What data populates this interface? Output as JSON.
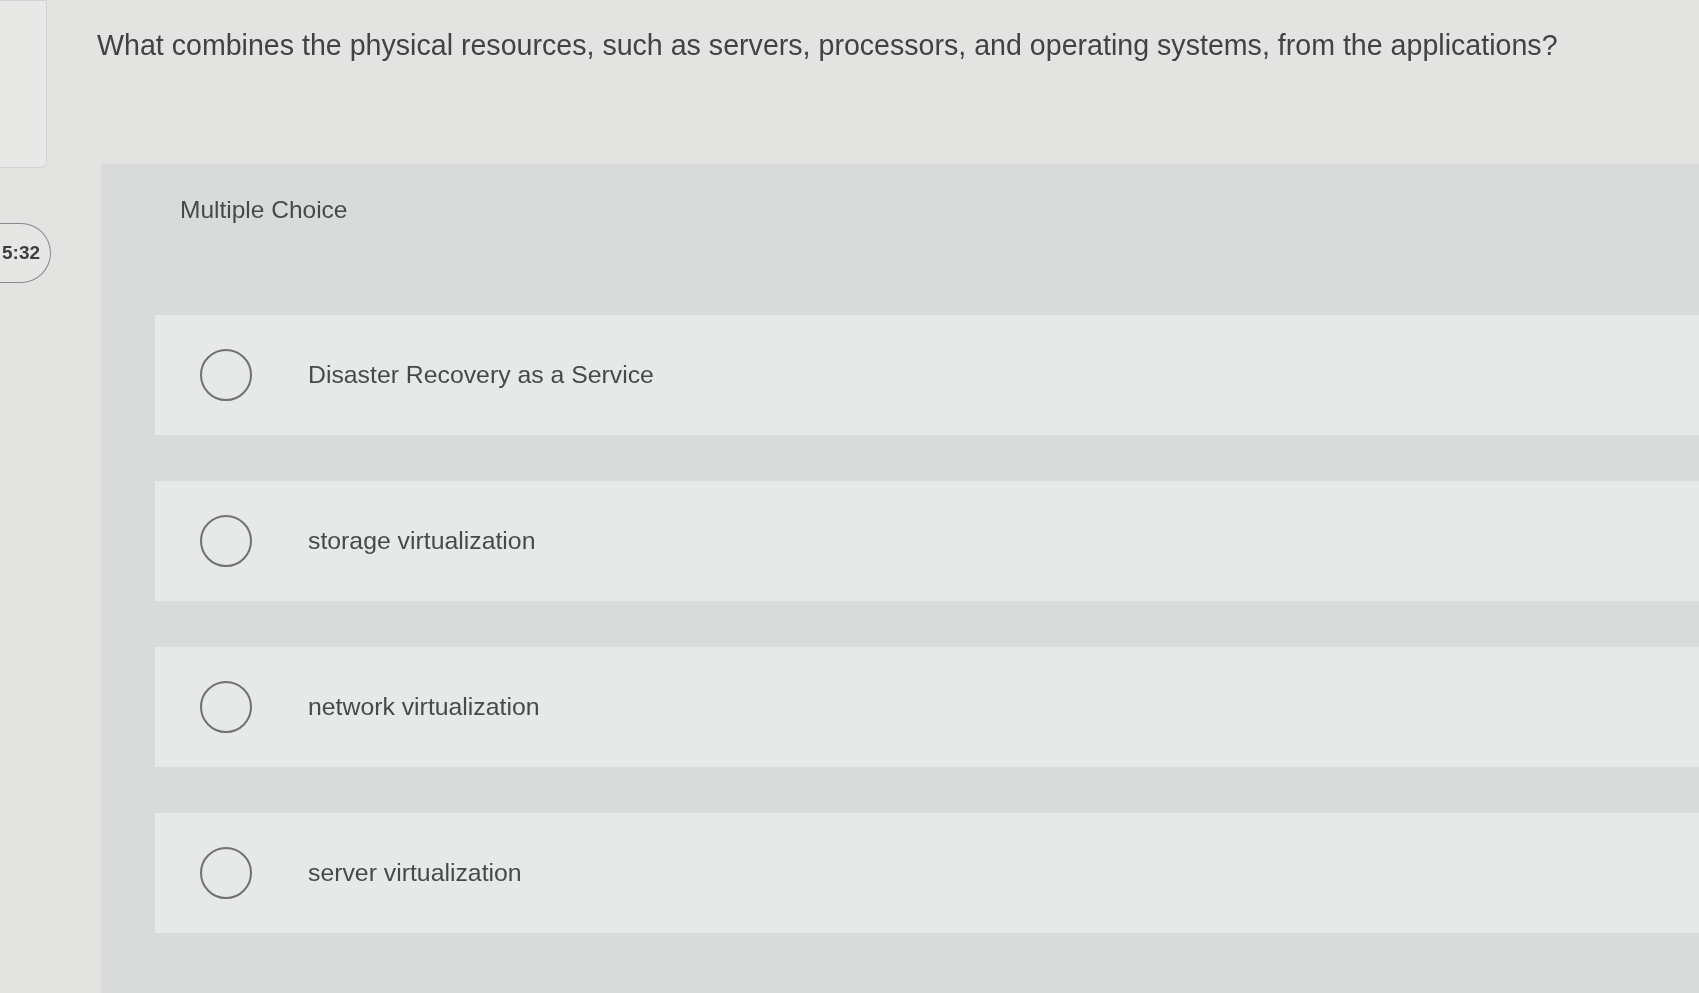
{
  "timer": {
    "text": "5:32"
  },
  "question": {
    "text": "What combines the physical resources, such as servers, processors, and operating systems, from the applications?"
  },
  "quiz": {
    "label": "Multiple Choice",
    "options": [
      {
        "label": "Disaster Recovery as a Service",
        "selected": false
      },
      {
        "label": "storage virtualization",
        "selected": false
      },
      {
        "label": "network virtualization",
        "selected": false
      },
      {
        "label": "server virtualization",
        "selected": false
      }
    ]
  }
}
